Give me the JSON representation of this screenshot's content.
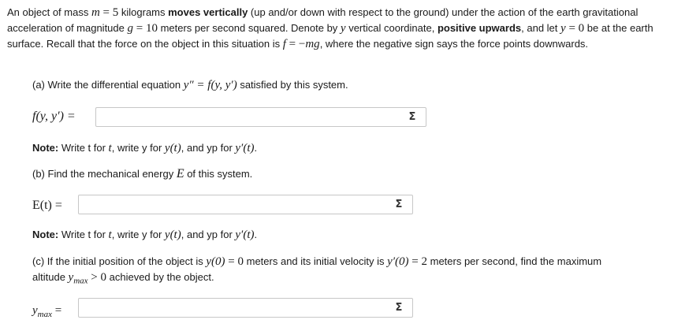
{
  "intro": {
    "t1": "An object of mass ",
    "m_sym": "m",
    "eq1": " = 5",
    "t2": " kilograms ",
    "bold1": "moves vertically",
    "t3": " (up and/or down with respect to the ground) under the action of the earth gravitational acceleration of magnitude ",
    "g_sym": "g",
    "eq2": " = 10",
    "t4": " meters per second squared. Denote by ",
    "y_sym": "y",
    "t5": " vertical coordinate, ",
    "bold2": "positive upwards",
    "t6": ", and let ",
    "y_eq": "y",
    "eq3": " = 0",
    "t7": " be at the earth surface. Recall that the force on the object in this situation is ",
    "f_sym": "f",
    "eq4": " = −",
    "mg": "mg",
    "t8": ", where the negative sign says the force points downwards."
  },
  "part_a": {
    "pre": "(a) Write the differential equation ",
    "math": "y″ = f(y, y′)",
    "post": " satisfied by this system.",
    "label": "f(y, y′) =",
    "note_bold": "Note:",
    "note_t1": " Write t for ",
    "note_m1": "t",
    "note_t2": ", write y for ",
    "note_m2": "y(t)",
    "note_t3": ", and yp for ",
    "note_m3": "y′(t)",
    "note_t4": "."
  },
  "part_b": {
    "pre": "(b) Find the mechanical energy ",
    "math": "E",
    "post": " of this system.",
    "label": "E(t) =",
    "note_bold": "Note:",
    "note_t1": " Write t for ",
    "note_m1": "t",
    "note_t2": ", write y for ",
    "note_m2": "y(t)",
    "note_t3": ", and yp for ",
    "note_m3": "y′(t)",
    "note_t4": "."
  },
  "part_c": {
    "pre": "(c) If the initial position of the object is ",
    "m1": "y(0)",
    "eq1": " = 0",
    "mid": " meters and its initial velocity is ",
    "m2": "y′(0)",
    "eq2": " = 2",
    "post": " meters per second, find the maximum",
    "line2_pre": "altitude ",
    "ymax": "y",
    "ymax_sub": "max",
    "gt": " > 0",
    "line2_post": " achieved by the object.",
    "label": "y",
    "label_sub": "max",
    "label_eq": " ="
  },
  "inputs": {
    "a_value": "",
    "b_value": "",
    "c_value": ""
  },
  "icons": {
    "sigma_glyph": "Σ",
    "name": "equation-editor-icon"
  }
}
